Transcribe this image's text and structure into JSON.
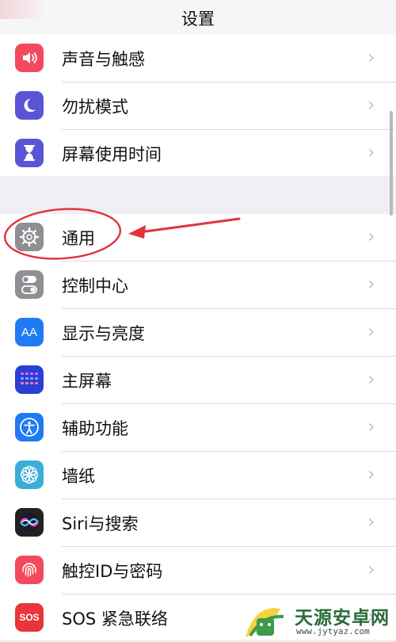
{
  "nav": {
    "title": "设置"
  },
  "groups": [
    {
      "items": [
        {
          "label": "声音与触感",
          "icon": "speaker-icon",
          "color": "#f24a5d"
        },
        {
          "label": "勿扰模式",
          "icon": "moon-icon",
          "color": "#5a54d6"
        },
        {
          "label": "屏幕使用时间",
          "icon": "hourglass-icon",
          "color": "#5a54d6"
        }
      ]
    },
    {
      "items": [
        {
          "label": "通用",
          "icon": "gear-icon",
          "color": "#8e8e93"
        },
        {
          "label": "控制中心",
          "icon": "toggle-icon",
          "color": "#8e8e93"
        },
        {
          "label": "显示与亮度",
          "icon": "text-size-icon",
          "icon_text": "AA",
          "color": "#1f7bf2"
        },
        {
          "label": "主屏幕",
          "icon": "grid-icon",
          "color": "#2a3fd4"
        },
        {
          "label": "辅助功能",
          "icon": "accessibility-icon",
          "color": "#1f7bf2"
        },
        {
          "label": "墙纸",
          "icon": "flower-icon",
          "color": "#3aaedb"
        },
        {
          "label": "Siri与搜索",
          "icon": "siri-icon",
          "color": "#222222"
        },
        {
          "label": "触控ID与密码",
          "icon": "fingerprint-icon",
          "color": "#f24a5d"
        },
        {
          "label": "SOS 紧急联络",
          "icon": "sos-icon",
          "icon_text": "SOS",
          "color": "#e8353b"
        }
      ]
    }
  ],
  "chevron": "›",
  "annotation": {
    "color": "#e0333b",
    "target": "通用"
  },
  "watermark": {
    "brand": "天源安卓网",
    "url": "www.jytyaz.com"
  }
}
